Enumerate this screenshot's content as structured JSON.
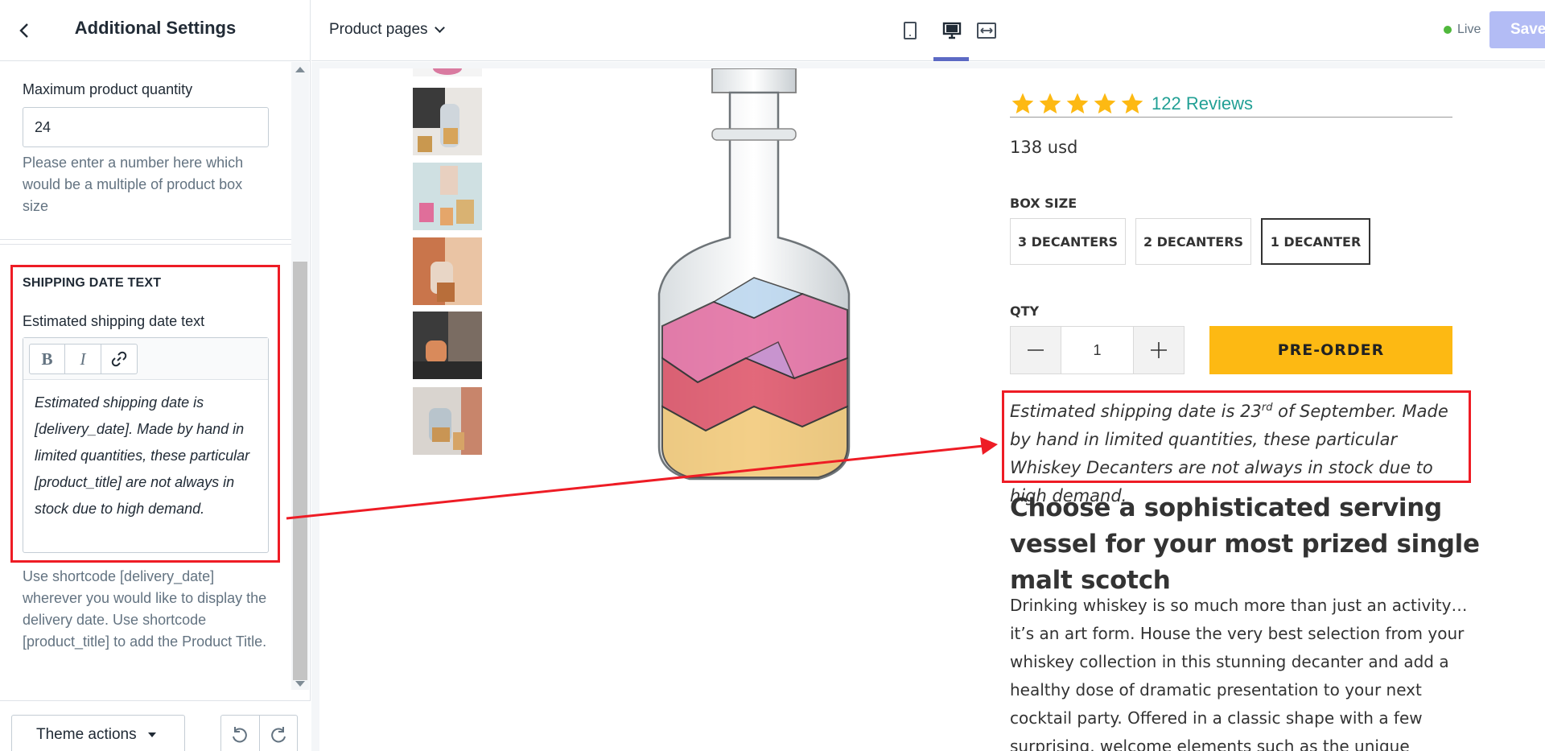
{
  "sidebar": {
    "title": "Additional Settings",
    "max_qty": {
      "label": "Maximum product quantity",
      "value": "24",
      "help": "Please enter a number here which would be a multiple of product box size"
    },
    "shipping_section": {
      "heading": "SHIPPING DATE TEXT",
      "field_label": "Estimated shipping date text",
      "toolbar": {
        "bold": "B",
        "italic": "I"
      },
      "content": "Estimated shipping date is [delivery_date]. Made by hand in limited quantities, these particular [product_title] are not always in stock due to high demand.",
      "help": "Use shortcode [delivery_date] wherever you would like to display the delivery date. Use shortcode [product_title] to add the Product Title."
    },
    "footer": {
      "theme_actions": "Theme actions"
    }
  },
  "topbar": {
    "page_selector": "Product pages",
    "status": "Live",
    "save": "Save",
    "active_device": "desktop"
  },
  "product": {
    "reviews": "122 Reviews",
    "rating": 5,
    "price": "138 usd",
    "box_size_label": "BOX SIZE",
    "box_sizes": [
      "3 DECANTERS",
      "2 DECANTERS",
      "1 DECANTER"
    ],
    "selected_box_size": "1 DECANTER",
    "qty_label": "QTY",
    "qty_value": "1",
    "cta": "PRE-ORDER",
    "ship_prefix": "Estimated shipping date is 23",
    "ship_sup": "rd",
    "ship_suffix": " of September. Made by hand in limited quantities, these particular Whiskey Decanters are not always in stock due to high demand.",
    "heading": "Choose a sophisticated serving vessel for your most prized single malt scotch",
    "description": "Drinking whiskey is so much more than just an activity… it’s an art form. House the very best selection from your whiskey collection in this stunning decanter and add a healthy dose of dramatic presentation to your next cocktail party. Offered in a classic shape with a few surprising, welcome elements such as the unique"
  },
  "colors": {
    "accent": "#5c6ac4",
    "highlight": "#ee1c25",
    "cta": "#fdb913",
    "star": "#fdb913",
    "reviews_link": "#22a095",
    "live": "#50b83c"
  }
}
